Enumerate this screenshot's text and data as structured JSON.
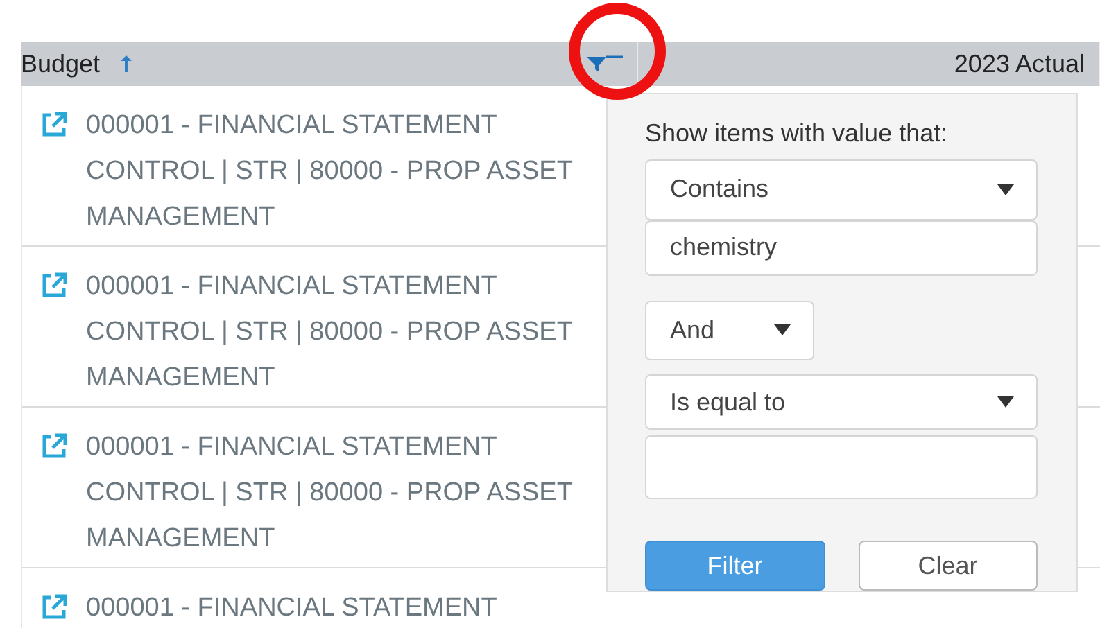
{
  "header": {
    "columns": [
      {
        "label": "Budget",
        "sorted": true,
        "filter_active": true
      },
      {
        "label": "2023 Actual"
      }
    ]
  },
  "rows": [
    {
      "lines": [
        "000001 - FINANCIAL STATEMENT",
        "CONTROL | STR | 80000 - PROP ASSET",
        "MANAGEMENT"
      ]
    },
    {
      "lines": [
        "000001 - FINANCIAL STATEMENT",
        "CONTROL | STR | 80000 - PROP ASSET",
        "MANAGEMENT"
      ]
    },
    {
      "lines": [
        "000001 - FINANCIAL STATEMENT",
        "CONTROL | STR | 80000 - PROP ASSET",
        "MANAGEMENT"
      ]
    },
    {
      "lines": [
        "000001 - FINANCIAL STATEMENT"
      ]
    }
  ],
  "filter_popup": {
    "label": "Show items with value that:",
    "operator_1": "Contains",
    "value_1": "chemistry",
    "logic": "And",
    "operator_2": "Is equal to",
    "buttons": [
      {
        "label": "Filter",
        "kind": "primary"
      },
      {
        "label": "Clear",
        "kind": "secondary"
      }
    ]
  }
}
